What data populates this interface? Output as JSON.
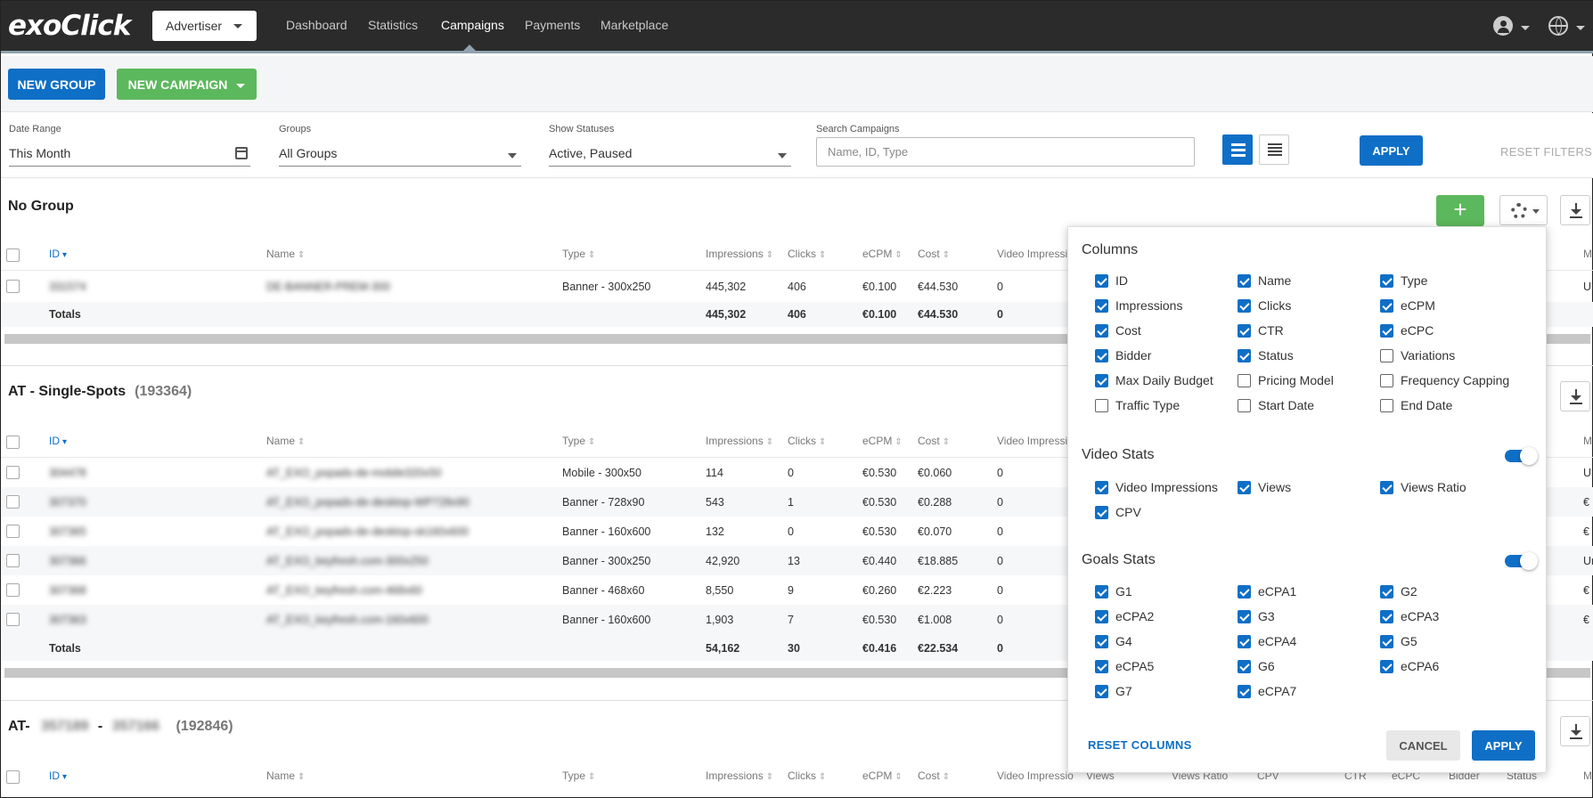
{
  "brand": {
    "logo": "exoClick"
  },
  "nav": {
    "account_selector": "Advertiser",
    "items": [
      "Dashboard",
      "Statistics",
      "Campaigns",
      "Payments",
      "Marketplace"
    ],
    "active": "Campaigns"
  },
  "toolbar": {
    "new_group": "NEW GROUP",
    "new_campaign": "NEW CAMPAIGN"
  },
  "filters": {
    "date_range": {
      "label": "Date Range",
      "value": "This Month"
    },
    "groups": {
      "label": "Groups",
      "value": "All Groups"
    },
    "statuses": {
      "label": "Show Statuses",
      "value": "Active, Paused"
    },
    "search": {
      "label": "Search Campaigns",
      "placeholder": "Name, ID, Type"
    },
    "apply": "APPLY",
    "reset": "RESET FILTERS"
  },
  "table_headers": [
    "ID",
    "Name",
    "Type",
    "Impressions",
    "Clicks",
    "eCPM",
    "Cost",
    "Video Impressio"
  ],
  "group3_extra_headers": [
    "Views",
    "Views Ratio",
    "CPV",
    "CTR",
    "eCPC",
    "Bidder",
    "Status",
    "M"
  ],
  "groups": [
    {
      "title": "No Group",
      "count": "",
      "rows": [
        {
          "id": "331574",
          "name": "DE-BANNER-PREM-300",
          "type": "Banner - 300x250",
          "impressions": "445,302",
          "clicks": "406",
          "ecpm": "€0.100",
          "cost": "€44.530",
          "video": "0",
          "edge": "Ur"
        }
      ],
      "totals": {
        "label": "Totals",
        "impressions": "445,302",
        "clicks": "406",
        "ecpm": "€0.100",
        "cost": "€44.530",
        "video": "0"
      }
    },
    {
      "title": "AT - Single-Spots",
      "count": "(193364)",
      "rows": [
        {
          "id": "304478",
          "name": "AT_EXO_popads-de-mobile320x50",
          "type": "Mobile - 300x50",
          "impressions": "114",
          "clicks": "0",
          "ecpm": "€0.530",
          "cost": "€0.060",
          "video": "0",
          "edge": "Ur"
        },
        {
          "id": "307370",
          "name": "AT_EXO_popads-de-desktop-WP728x90",
          "type": "Banner - 728x90",
          "impressions": "543",
          "clicks": "1",
          "ecpm": "€0.530",
          "cost": "€0.288",
          "video": "0",
          "edge": "€"
        },
        {
          "id": "307365",
          "name": "AT_EXO_popads-de-desktop-sk160x600",
          "type": "Banner - 160x600",
          "impressions": "132",
          "clicks": "0",
          "ecpm": "€0.530",
          "cost": "€0.070",
          "video": "0",
          "edge": "€"
        },
        {
          "id": "307366",
          "name": "AT_EXO_keyfresh.com-300x250",
          "type": "Banner - 300x250",
          "impressions": "42,920",
          "clicks": "13",
          "ecpm": "€0.440",
          "cost": "€18.885",
          "video": "0",
          "edge": "Ur"
        },
        {
          "id": "307368",
          "name": "AT_EXO_keyfresh.com-468x60",
          "type": "Banner - 468x60",
          "impressions": "8,550",
          "clicks": "9",
          "ecpm": "€0.260",
          "cost": "€2.223",
          "video": "0",
          "edge": "€"
        },
        {
          "id": "307363",
          "name": "AT_EXO_keyfresh.com-160x600",
          "type": "Banner - 160x600",
          "impressions": "1,903",
          "clicks": "7",
          "ecpm": "€0.530",
          "cost": "€1.008",
          "video": "0",
          "edge": "€"
        }
      ],
      "totals": {
        "label": "Totals",
        "impressions": "54,162",
        "clicks": "30",
        "ecpm": "€0.416",
        "cost": "€22.534",
        "video": "0"
      }
    },
    {
      "title_prefix": "AT-",
      "title_blur_1": "357189",
      "title_sep": "-",
      "title_blur_2": "357166",
      "count": "(192846)"
    }
  ],
  "columns_panel": {
    "columns_title": "Columns",
    "columns": [
      {
        "label": "ID",
        "checked": true
      },
      {
        "label": "Name",
        "checked": true
      },
      {
        "label": "Type",
        "checked": true
      },
      {
        "label": "Impressions",
        "checked": true
      },
      {
        "label": "Clicks",
        "checked": true
      },
      {
        "label": "eCPM",
        "checked": true
      },
      {
        "label": "Cost",
        "checked": true
      },
      {
        "label": "CTR",
        "checked": true
      },
      {
        "label": "eCPC",
        "checked": true
      },
      {
        "label": "Bidder",
        "checked": true
      },
      {
        "label": "Status",
        "checked": true
      },
      {
        "label": "Variations",
        "checked": false
      },
      {
        "label": "Max Daily Budget",
        "checked": true
      },
      {
        "label": "Pricing Model",
        "checked": false
      },
      {
        "label": "Frequency Capping",
        "checked": false
      },
      {
        "label": "Traffic Type",
        "checked": false
      },
      {
        "label": "Start Date",
        "checked": false
      },
      {
        "label": "End Date",
        "checked": false
      }
    ],
    "video_title": "Video Stats",
    "video_enabled": true,
    "video": [
      {
        "label": "Video Impressions",
        "checked": true
      },
      {
        "label": "Views",
        "checked": true
      },
      {
        "label": "Views Ratio",
        "checked": true
      },
      {
        "label": "CPV",
        "checked": true
      }
    ],
    "goals_title": "Goals Stats",
    "goals_enabled": true,
    "goals": [
      {
        "label": "G1",
        "checked": true
      },
      {
        "label": "eCPA1",
        "checked": true
      },
      {
        "label": "G2",
        "checked": true
      },
      {
        "label": "eCPA2",
        "checked": true
      },
      {
        "label": "G3",
        "checked": true
      },
      {
        "label": "eCPA3",
        "checked": true
      },
      {
        "label": "G4",
        "checked": true
      },
      {
        "label": "eCPA4",
        "checked": true
      },
      {
        "label": "G5",
        "checked": true
      },
      {
        "label": "eCPA5",
        "checked": true
      },
      {
        "label": "G6",
        "checked": true
      },
      {
        "label": "eCPA6",
        "checked": true
      },
      {
        "label": "G7",
        "checked": true
      },
      {
        "label": "eCPA7",
        "checked": true
      }
    ],
    "reset": "RESET COLUMNS",
    "cancel": "CANCEL",
    "apply": "APPLY"
  },
  "colors": {
    "primary": "#0f6fc6",
    "success": "#5cb85c",
    "topbar": "#2b2b2b"
  }
}
